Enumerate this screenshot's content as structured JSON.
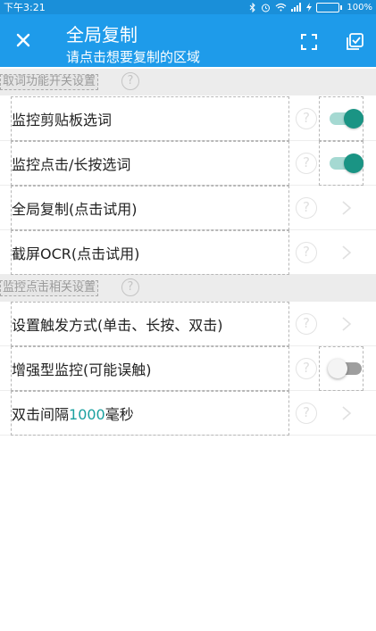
{
  "status_bar": {
    "time": "下午3:21",
    "battery": "100%",
    "battery_level": 1.0,
    "battery_color": "#7ed957"
  },
  "app_bar": {
    "title": "全局复制",
    "subtitle": "请点击想要复制的区域",
    "close_icon": "close-icon",
    "fullscreen_icon": "fullscreen-icon",
    "copy_all_icon": "copy-all-icon",
    "background": "#1e9bea"
  },
  "sections": [
    {
      "label": "取词功能开关设置",
      "help": "?",
      "rows": [
        {
          "text": "监控剪贴板选词",
          "help": "?",
          "control": "switch",
          "on": true
        },
        {
          "text": "监控点击/长按选词",
          "help": "?",
          "control": "switch",
          "on": true
        },
        {
          "text": "全局复制(点击试用)",
          "help": "?",
          "control": "chevron"
        },
        {
          "text": "截屏OCR(点击试用)",
          "help": "?",
          "control": "chevron"
        }
      ]
    },
    {
      "label": "监控点击相关设置",
      "help": "?",
      "rows": [
        {
          "text": "设置触发方式(单击、长按、双击)",
          "help": "?",
          "control": "chevron"
        },
        {
          "text": "增强型监控(可能误触)",
          "help": "?",
          "control": "switch",
          "on": false
        },
        {
          "text_prefix": "双击间隔",
          "text_value": "1000",
          "text_suffix": "毫秒",
          "help": "?",
          "control": "chevron"
        }
      ]
    }
  ],
  "colors": {
    "switch_on_knob": "#1a9484",
    "switch_on_track": "#a5d9d2",
    "accent_value": "#1aa1a0"
  }
}
